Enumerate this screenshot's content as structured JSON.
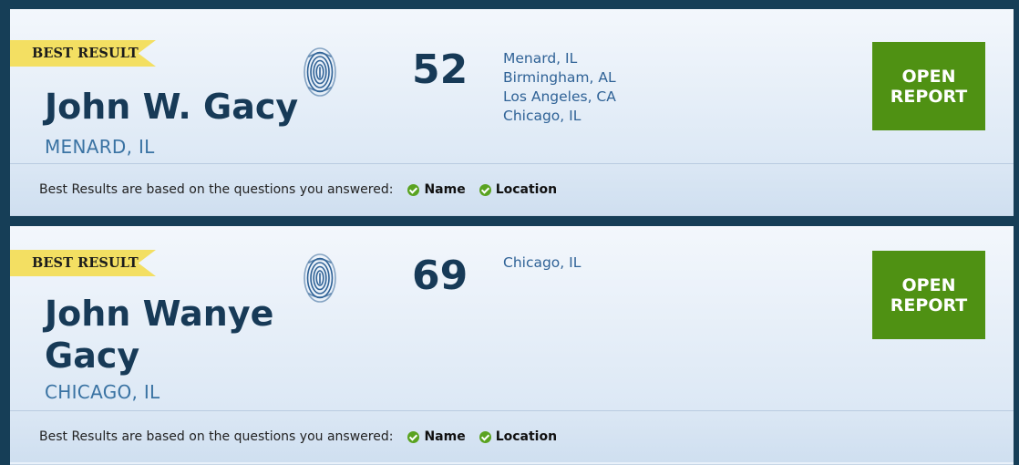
{
  "results": [
    {
      "badge": "BEST RESULT",
      "name": "John W. Gacy",
      "location": "MENARD, IL",
      "age": "52",
      "places": [
        "Menard, IL",
        "Birmingham, AL",
        "Los Angeles, CA",
        "Chicago, IL"
      ],
      "button": {
        "line1": "OPEN",
        "line2": "REPORT"
      },
      "footer": {
        "text": "Best Results are based on the questions you answered:",
        "criteria": [
          "Name",
          "Location"
        ]
      }
    },
    {
      "badge": "BEST RESULT",
      "name_line1": "John Wanye",
      "name_line2": "Gacy",
      "location": "CHICAGO, IL",
      "age": "69",
      "places": [
        "Chicago, IL"
      ],
      "button": {
        "line1": "OPEN",
        "line2": "REPORT"
      },
      "footer": {
        "text": "Best Results are based on the questions you answered:",
        "criteria": [
          "Name",
          "Location"
        ]
      }
    }
  ],
  "colors": {
    "background": "#163e57",
    "card": "#e9f1fa",
    "badge": "#f3df62",
    "button": "#4f9113",
    "name": "#173a57",
    "location": "#3a73a3",
    "check": "#5aa320"
  },
  "icons": [
    "fingerprint-icon",
    "check-circle-icon"
  ]
}
